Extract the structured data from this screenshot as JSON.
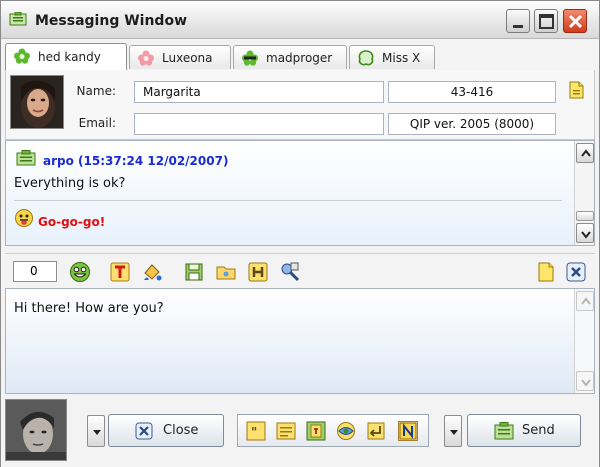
{
  "window": {
    "title": "Messaging Window"
  },
  "tabs": [
    {
      "label": "hed kandy",
      "icon": "flower-green-icon",
      "active": true
    },
    {
      "label": "Luxeona",
      "icon": "flower-pink-icon",
      "active": false
    },
    {
      "label": "madproger",
      "icon": "flower-glasses-icon",
      "active": false
    },
    {
      "label": "Miss X",
      "icon": "flower-outline-icon",
      "active": false
    }
  ],
  "contact": {
    "name_label": "Name:",
    "name_value": "Margarita",
    "uin": "43-416",
    "email_label": "Email:",
    "email_value": "",
    "client": "QIP ver. 2005 (8000)"
  },
  "history": {
    "messages": [
      {
        "sender": "arpo (15:37:24 12/02/2007)",
        "text": "Everything is ok?"
      },
      {
        "sender": "",
        "text": "Go-go-go!"
      }
    ]
  },
  "toolbar": {
    "counter": "0"
  },
  "input": {
    "text": "Hi there! How are you?"
  },
  "bottom": {
    "close_label": "Close",
    "send_label": "Send"
  },
  "colors": {
    "sender": "#1a2bd4",
    "alert": "#e01010",
    "accent": "#4a9a2a"
  }
}
